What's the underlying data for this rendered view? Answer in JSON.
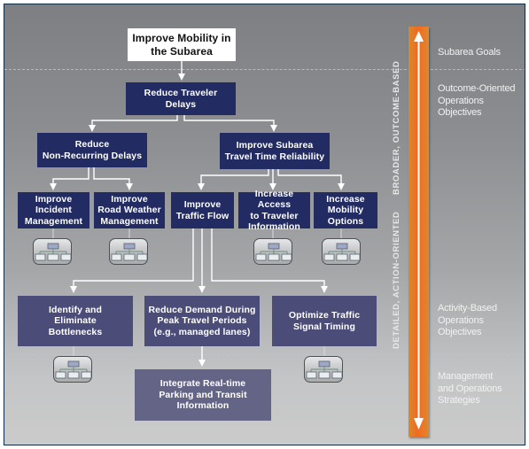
{
  "diagram": {
    "title_goal": "Improve Mobility in\nthe Subarea",
    "level1": {
      "reduce_traveler_delays": "Reduce Traveler\nDelays"
    },
    "level2": {
      "reduce_nonrecurring": "Reduce\nNon-Recurring Delays",
      "improve_reliability": "Improve Subarea\nTravel Time Reliability"
    },
    "level3": {
      "incident_management": "Improve\nIncident\nManagement",
      "road_weather": "Improve\nRoad Weather\nManagement",
      "traffic_flow": "Improve\nTraffic Flow",
      "traveler_info": "Increase Access\nto Traveler\nInformation",
      "mobility_options": "Increase\nMobility\nOptions"
    },
    "activity": {
      "bottlenecks": "Identify and\nEliminate\nBottlenecks",
      "reduce_demand": "Reduce Demand During\nPeak Travel Periods\n(e.g., managed lanes)",
      "signal_timing": "Optimize Traffic\nSignal Timing"
    },
    "strategy": {
      "parking_transit": "Integrate Real-time\nParking and Transit\nInformation"
    },
    "scale": {
      "upper_label": "BROADER, OUTCOME-BASED",
      "lower_label": "DETAILED, ACTION-ORIENTED",
      "arrow_colors": [
        "#f06a22",
        "#d9892a"
      ]
    },
    "levels": [
      {
        "label": "Subarea Goals"
      },
      {
        "label": "Outcome-Oriented\nOperations\nObjectives"
      },
      {
        "label": "Activity-Based\nOperations\nObjectives"
      },
      {
        "label": "Management\nand Operations\nStrategies"
      }
    ],
    "colors": {
      "goal_box": "#ffffff",
      "objective_box": "#232c62",
      "activity_box": "#4b4c78",
      "strategy_box": "#636486",
      "connector": "#ffffff"
    }
  }
}
